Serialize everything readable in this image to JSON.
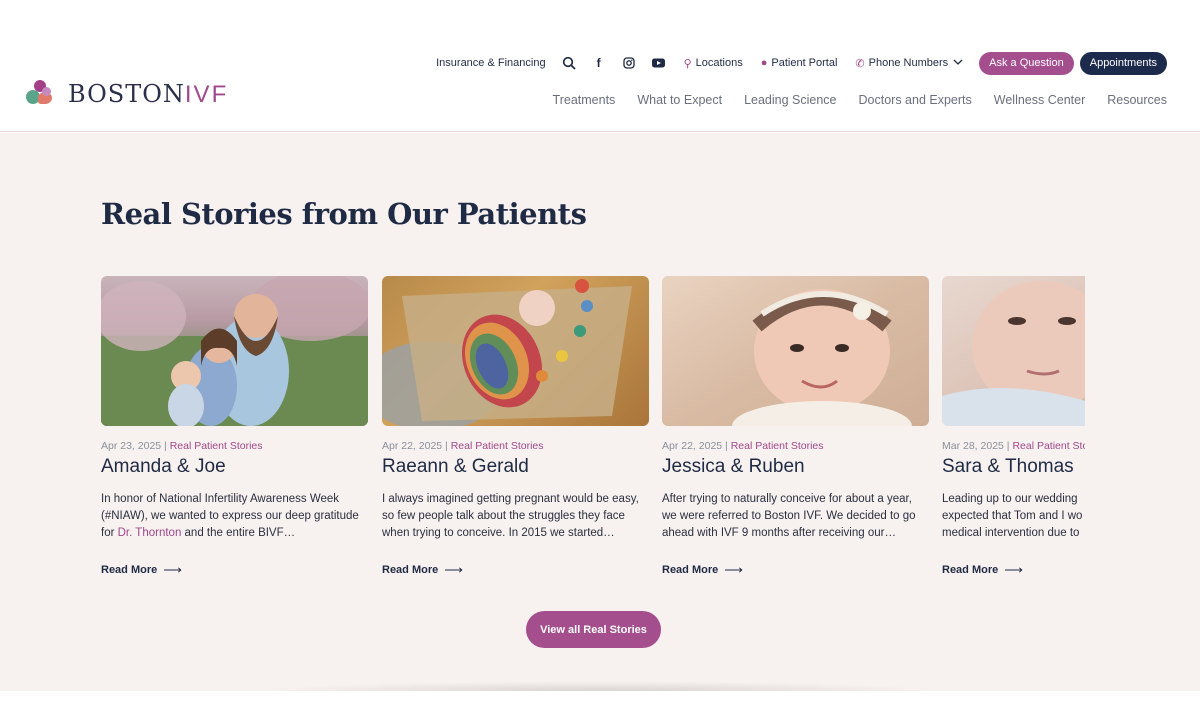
{
  "brand": {
    "name_main": "BOSTON",
    "name_accent": "IVF",
    "colors": {
      "plum": "#a54e8e",
      "navy": "#1c2a4c",
      "bg": "#f7f1ef"
    }
  },
  "utility": {
    "insurance": "Insurance & Financing",
    "search_icon": "search-icon",
    "locations": "Locations",
    "patient_portal": "Patient Portal",
    "phone_numbers": "Phone Numbers",
    "ask": "Ask a Question",
    "appointments": "Appointments"
  },
  "nav": [
    "Treatments",
    "What to Expect",
    "Leading Science",
    "Doctors and Experts",
    "Wellness Center",
    "Resources"
  ],
  "section_title": "Real Stories from Our Patients",
  "stories": [
    {
      "date": "Apr 23, 2025",
      "category": "Real Patient Stories",
      "name": "Amanda & Joe",
      "excerpt_pre": "In honor of National Infertility Awareness Week (#NIAW), we wanted to express our deep gratitude for ",
      "excerpt_link": "Dr. Thornton",
      "excerpt_post": " and the entire BIVF…",
      "more": "Read More"
    },
    {
      "date": "Apr 22, 2025",
      "category": "Real Patient Stories",
      "name": "Raeann & Gerald",
      "excerpt_pre": "I always imagined getting pregnant would be easy, so few people talk about the struggles they face when trying to conceive. In 2015 we started…",
      "excerpt_link": "",
      "excerpt_post": "",
      "more": "Read More"
    },
    {
      "date": "Apr 22, 2025",
      "category": "Real Patient Stories",
      "name": "Jessica & Ruben",
      "excerpt_pre": "After trying to naturally conceive for about a year, we were referred to Boston IVF. We decided to go ahead with IVF 9 months after receiving our…",
      "excerpt_link": "",
      "excerpt_post": "",
      "more": "Read More"
    },
    {
      "date": "Mar 28, 2025",
      "category": "Real Patient Sto",
      "name": "Sara & Thomas",
      "excerpt_pre": "Leading up to our wedding expected that Tom and I wo medical intervention due to",
      "excerpt_link": "",
      "excerpt_post": "",
      "more": "Read More"
    }
  ],
  "cta": "View all Real Stories"
}
